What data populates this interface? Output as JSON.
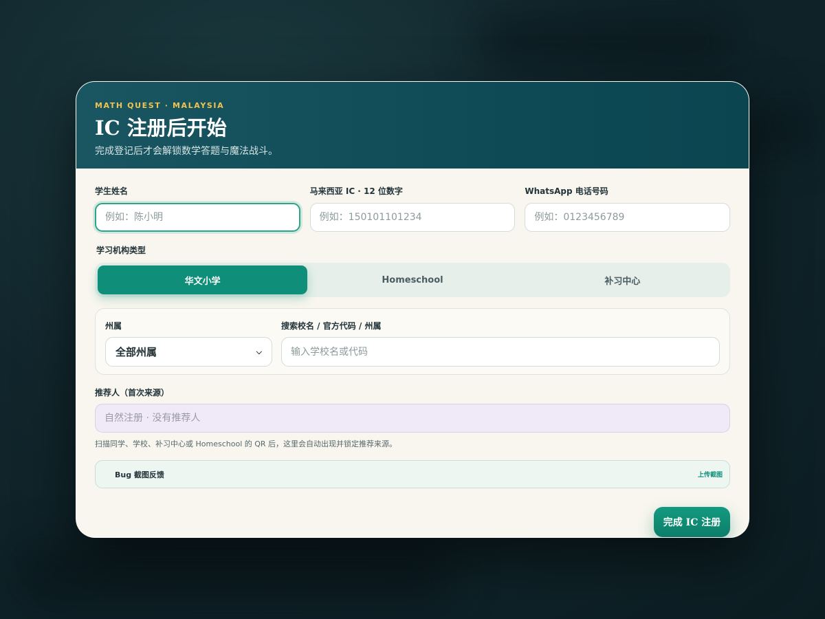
{
  "header": {
    "eyebrow": "MATH QUEST · MALAYSIA",
    "title": "IC 注册后开始",
    "subtitle": "完成登记后才会解锁数学答题与魔法战斗。"
  },
  "form": {
    "student_name": {
      "label": "学生姓名",
      "placeholder": "例如：陈小明",
      "value": ""
    },
    "ic": {
      "label": "马来西亚 IC · 12 位数字",
      "placeholder": "例如：150101101234",
      "value": ""
    },
    "whatsapp": {
      "label": "WhatsApp 电话号码",
      "placeholder": "例如：0123456789",
      "value": ""
    },
    "institution": {
      "label": "学习机构类型",
      "options": [
        "华文小学",
        "Homeschool",
        "补习中心"
      ],
      "selected": "华文小学"
    },
    "state": {
      "label": "州属",
      "value": "全部州属"
    },
    "school_search": {
      "label": "搜索校名 / 官方代码 / 州属",
      "placeholder": "输入学校名或代码",
      "value": ""
    },
    "referrer": {
      "label": "推荐人（首次来源）",
      "placeholder": "自然注册 · 没有推荐人",
      "hint": "扫描同学、学校、补习中心或 Homeschool 的 QR 后，这里会自动出现并锁定推荐来源。"
    },
    "bug": {
      "label": "Bug 截图反馈",
      "upload_label": "上传截图"
    },
    "submit_label": "完成 IC 注册"
  },
  "colors": {
    "accent": "#0f8f79",
    "header_bg": "#0e4b57",
    "eyebrow": "#f0c44f",
    "card_bg": "#f8f6ee",
    "referrer_bg": "#efe9f8"
  }
}
